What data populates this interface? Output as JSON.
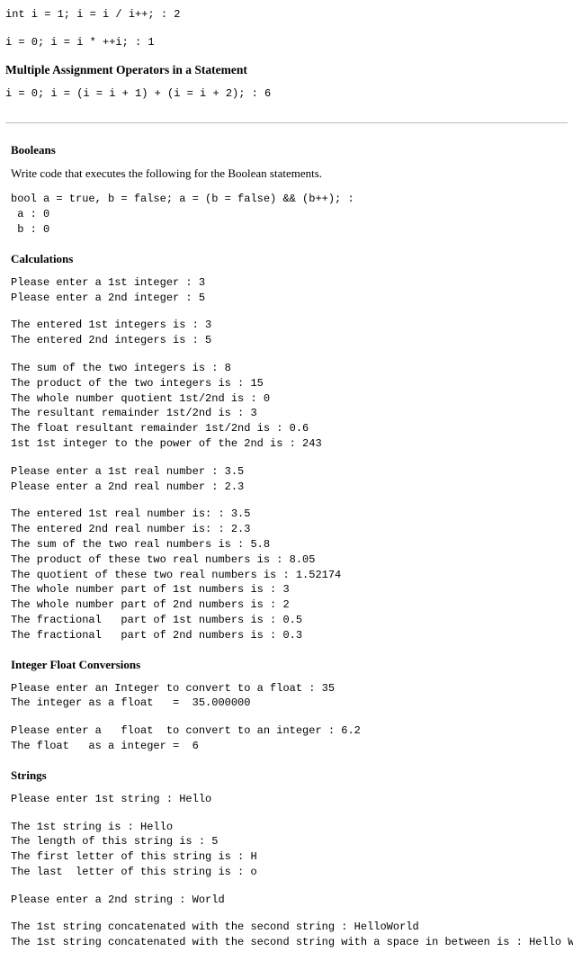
{
  "top": {
    "line1": "int i = 1; i = i / i++; : 2",
    "line2": "i = 0; i = i * ++i; : 1"
  },
  "multipleAssignment": {
    "heading": "Multiple Assignment Operators in a Statement",
    "code": "i = 0; i = (i = i + 1) + (i = i + 2); : 6"
  },
  "booleans": {
    "heading": "Booleans",
    "intro": "Write code that executes the following for the Boolean statements.",
    "code": "bool a = true, b = false; a = (b = false) && (b++); :\n a : 0\n b : 0"
  },
  "calculations": {
    "heading": "Calculations",
    "block1": "Please enter a 1st integer : 3\nPlease enter a 2nd integer : 5",
    "block2": "The entered 1st integers is : 3\nThe entered 2nd integers is : 5",
    "block3": "The sum of the two integers is : 8\nThe product of the two integers is : 15\nThe whole number quotient 1st/2nd is : 0\nThe resultant remainder 1st/2nd is : 3\nThe float resultant remainder 1st/2nd is : 0.6\n1st 1st integer to the power of the 2nd is : 243",
    "block4": "Please enter a 1st real number : 3.5\nPlease enter a 2nd real number : 2.3",
    "block5": "The entered 1st real number is: : 3.5\nThe entered 2nd real number is: : 2.3\nThe sum of the two real numbers is : 5.8\nThe product of these two real numbers is : 8.05\nThe quotient of these two real numbers is : 1.52174\nThe whole number part of 1st numbers is : 3\nThe whole number part of 2nd numbers is : 2\nThe fractional   part of 1st numbers is : 0.5\nThe fractional   part of 2nd numbers is : 0.3"
  },
  "intFloat": {
    "heading": "Integer Float Conversions",
    "block1": "Please enter an Integer to convert to a float : 35\nThe integer as a float   =  35.000000",
    "block2": "Please enter a   float  to convert to an integer : 6.2\nThe float   as a integer =  6"
  },
  "strings": {
    "heading": "Strings",
    "block1": "Please enter 1st string : Hello",
    "block2": "The 1st string is : Hello\nThe length of this string is : 5\nThe first letter of this string is : H\nThe last  letter of this string is : o",
    "block3": "Please enter a 2nd string : World",
    "block4": "The 1st string concatenated with the second string : HelloWorld\nThe 1st string concatenated with the second string with a space in between is : Hello World"
  }
}
